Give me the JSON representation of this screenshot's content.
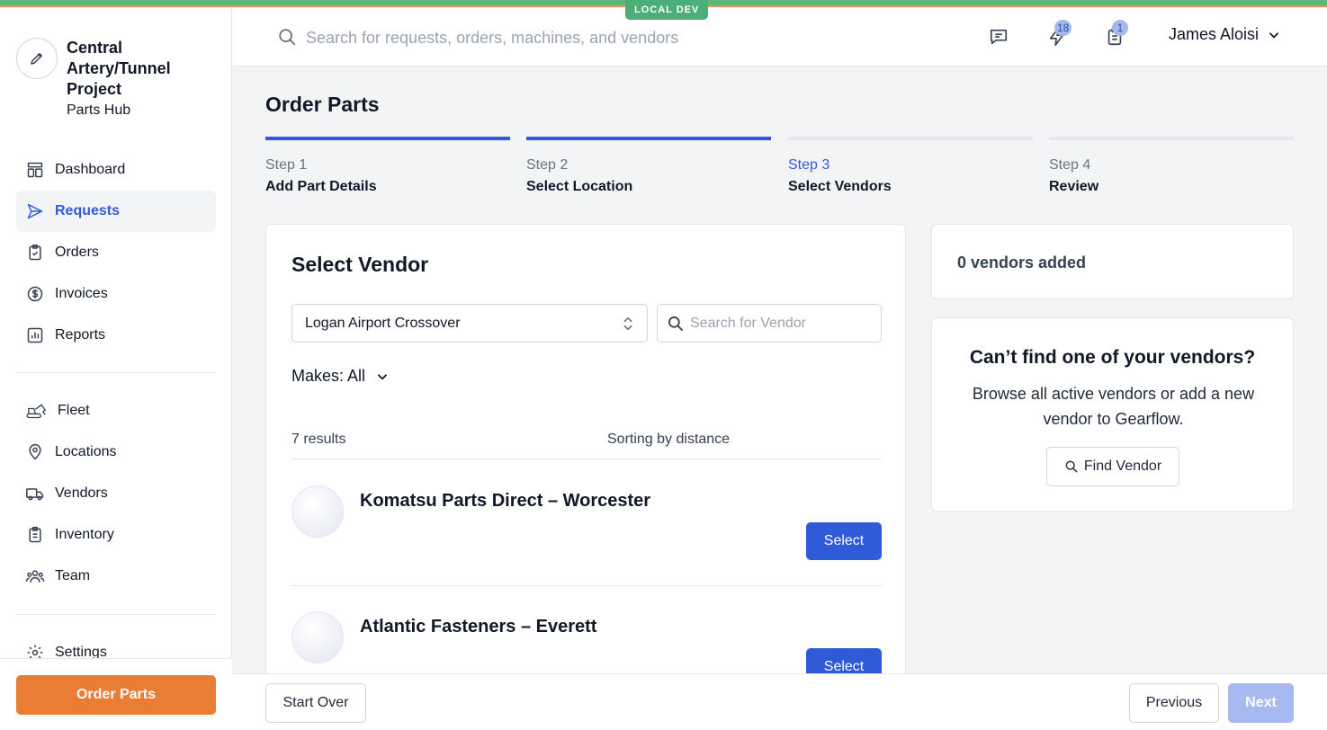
{
  "env_badge": "LOCAL DEV",
  "org": {
    "name": "Central Artery/Tunnel Project",
    "subtitle": "Parts Hub",
    "avatar_icon": "pencil-icon"
  },
  "sidebar": {
    "items": [
      {
        "label": "Dashboard",
        "icon": "dashboard-icon",
        "active": false
      },
      {
        "label": "Requests",
        "icon": "send-icon",
        "active": true
      },
      {
        "label": "Orders",
        "icon": "clipboard-check-icon",
        "active": false
      },
      {
        "label": "Invoices",
        "icon": "dollar-icon",
        "active": false
      },
      {
        "label": "Reports",
        "icon": "chart-icon",
        "active": false
      }
    ],
    "items2": [
      {
        "label": "Fleet",
        "icon": "excavator-icon"
      },
      {
        "label": "Locations",
        "icon": "map-pin-icon"
      },
      {
        "label": "Vendors",
        "icon": "truck-icon"
      },
      {
        "label": "Inventory",
        "icon": "clipboard-list-icon"
      },
      {
        "label": "Team",
        "icon": "users-icon"
      }
    ],
    "settings_label": "Settings",
    "order_button": "Order Parts"
  },
  "header": {
    "search_placeholder": "Search for requests, orders, machines, and vendors",
    "notifications_count": "18",
    "tasks_count": "1",
    "user_name": "James Aloisi"
  },
  "page": {
    "title": "Order Parts",
    "steps": [
      {
        "num": "Step 1",
        "label": "Add Part Details",
        "state": "done"
      },
      {
        "num": "Step 2",
        "label": "Select Location",
        "state": "done"
      },
      {
        "num": "Step 3",
        "label": "Select Vendors",
        "state": "current"
      },
      {
        "num": "Step 4",
        "label": "Review",
        "state": "todo"
      }
    ]
  },
  "vendor_panel": {
    "title": "Select Vendor",
    "location_value": "Logan Airport Crossover",
    "search_placeholder": "Search for Vendor",
    "makes_label": "Makes: All",
    "results_count": "7 results",
    "sorting_label": "Sorting by distance",
    "vendors": [
      {
        "name": "Komatsu Parts Direct – Worcester",
        "button": "Select"
      },
      {
        "name": "Atlantic Fasteners – Everett",
        "button": "Select"
      }
    ]
  },
  "summary": {
    "count_text": "0 vendors added"
  },
  "find_vendor": {
    "title": "Can’t find one of your vendors?",
    "description": "Browse all active vendors or add a new vendor to Gearflow.",
    "button": "Find Vendor"
  },
  "footer": {
    "start_over": "Start Over",
    "previous": "Previous",
    "next": "Next"
  },
  "colors": {
    "accent": "#2f5bd8",
    "order_button": "#e97d36",
    "next_disabled": "#a7b9ee"
  }
}
